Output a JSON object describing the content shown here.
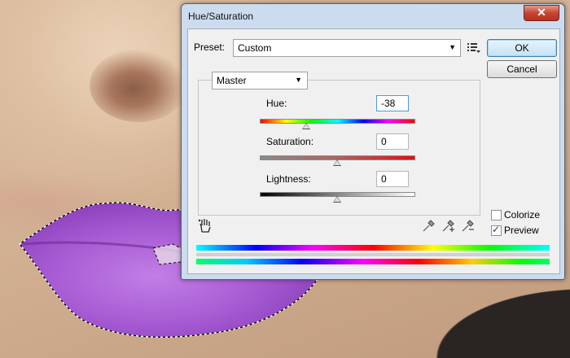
{
  "dialog": {
    "title": "Hue/Saturation",
    "close_glyph": "✕",
    "preset_label": "Preset:",
    "preset_value": "Custom",
    "ok_label": "OK",
    "cancel_label": "Cancel",
    "channel_value": "Master",
    "hue": {
      "label": "Hue:",
      "value": "-38",
      "fraction": 0.3
    },
    "saturation": {
      "label": "Saturation:",
      "value": "0",
      "fraction": 0.5
    },
    "lightness": {
      "label": "Lightness:",
      "value": "0",
      "fraction": 0.5
    },
    "colorize": {
      "label": "Colorize",
      "checked": false
    },
    "preview": {
      "label": "Preview",
      "checked": true
    }
  },
  "icons": [
    "preset-options-icon",
    "target-adjustment-hand-icon",
    "eyedropper-icon",
    "eyedropper-add-icon",
    "eyedropper-subtract-icon",
    "dropdown-arrow-icon"
  ]
}
